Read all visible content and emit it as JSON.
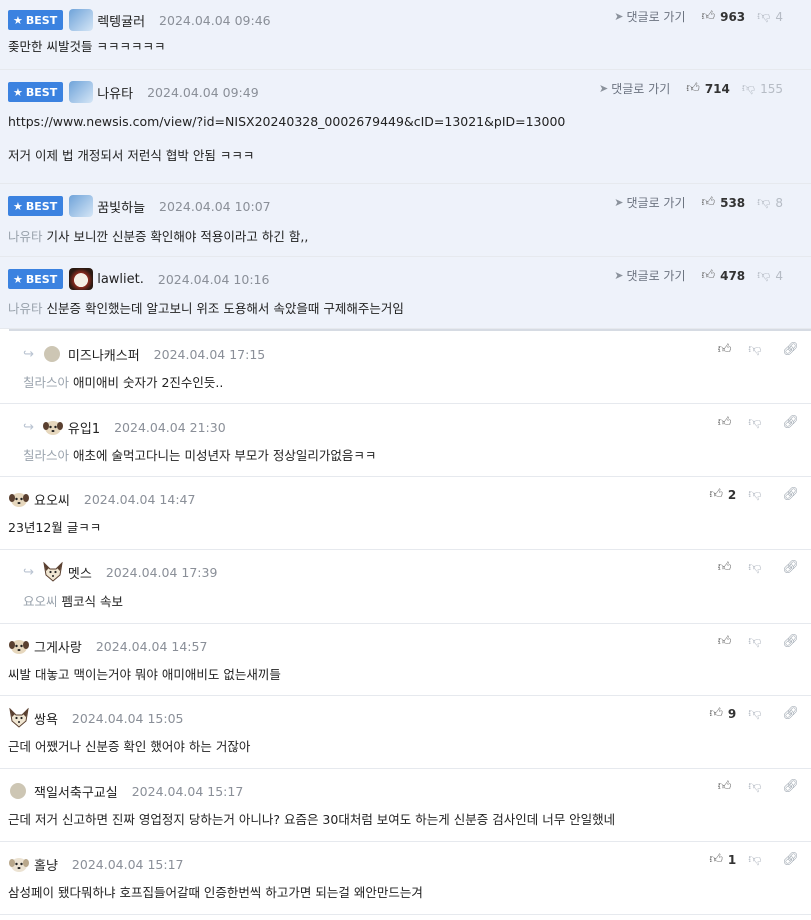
{
  "ui": {
    "best_label": "BEST",
    "goto_label": "댓글로 가기",
    "icons": {
      "star": "star-icon",
      "like": "thumbs-up-icon",
      "dislike": "thumbs-down-icon",
      "link": "link-icon",
      "send": "send-icon",
      "reply": "reply-arrow-icon"
    },
    "colors": {
      "best_badge": "#3b82e0",
      "best_bg": "#eef2fa",
      "muted": "#8a8f98"
    }
  },
  "comments": [
    {
      "nick": "렉텡귤러",
      "date": "2024.04.04 09:46",
      "text": "좆만한 씨발것들 ㅋㅋㅋㅋㅋㅋ",
      "likes": "963",
      "dislikes": "4"
    },
    {
      "nick": "나유타",
      "date": "2024.04.04 09:49",
      "text": "https://www.newsis.com/view/?id=NISX20240328_0002679449&cID=13021&pID=13000\n\n저거 이제 법 개정되서 저런식 협박 안됨 ㅋㅋㅋ",
      "likes": "714",
      "dislikes": "155"
    },
    {
      "nick": "꿈빛하늘",
      "date": "2024.04.04 10:07",
      "mention": "나유타",
      "text": "기사 보니깐 신분증 확인해야 적용이라고 하긴 함,,",
      "likes": "538",
      "dislikes": "8"
    },
    {
      "nick": "lawliet.",
      "date": "2024.04.04 10:16",
      "mention": "나유타",
      "text": "신분증 확인했는데 알고보니 위조 도용해서 속았을때 구제해주는거임",
      "likes": "478",
      "dislikes": "4"
    },
    {
      "nick": "미즈나캐스퍼",
      "date": "2024.04.04 17:15",
      "mention": "칠라스아",
      "text": "애미애비 숫자가 2진수인듯.."
    },
    {
      "nick": "유입1",
      "date": "2024.04.04 21:30",
      "mention": "칠라스아",
      "text": "애초에 술먹고다니는 미성년자 부모가 정상일리가없음ㅋㅋ"
    },
    {
      "nick": "요오씨",
      "date": "2024.04.04 14:47",
      "text": "23년12월 글ㅋㅋ",
      "likes": "2"
    },
    {
      "nick": "멧스",
      "date": "2024.04.04 17:39",
      "mention": "요오씨",
      "text": "펨코식 속보"
    },
    {
      "nick": "그게사랑",
      "date": "2024.04.04 14:57",
      "text": "씨발 대놓고 맥이는거야 뭐야 애미애비도 없는새끼들"
    },
    {
      "nick": "쌍욕",
      "date": "2024.04.04 15:05",
      "text": "근데 어쨌거나 신분증 확인 했어야 하는 거잖아",
      "likes": "9"
    },
    {
      "nick": "잭일서축구교실",
      "date": "2024.04.04 15:17",
      "text": "근데 저거 신고하면 진짜 영업정지 당하는거 아니나? 요즘은 30대처럼 보여도 하는게 신분증 검사인데 너무 안일했네"
    },
    {
      "nick": "홀냥",
      "date": "2024.04.04 15:17",
      "text": "삼성페이 됐다뭐하냐 호프집들어갈때 인증한번씩 하고가면 되는걸 왜안만드는겨",
      "likes": "1"
    }
  ]
}
